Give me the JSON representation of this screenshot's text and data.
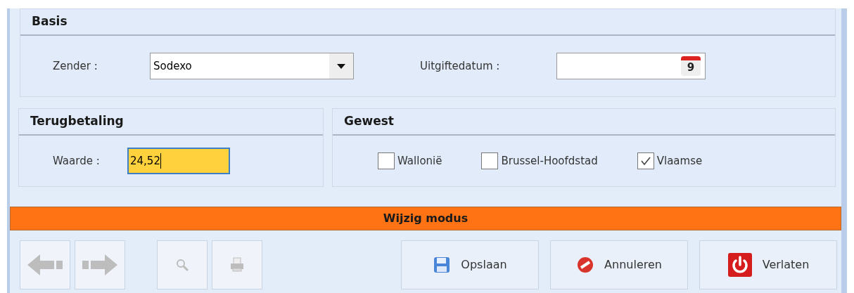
{
  "basis": {
    "title": "Basis",
    "sender": {
      "label": "Zender :",
      "value": "Sodexo"
    },
    "issue_date": {
      "label": "Uitgiftedatum :",
      "calendar_day": "9"
    }
  },
  "refund": {
    "title": "Terugbetaling",
    "amount": {
      "label": "Waarde :",
      "value": "24,52",
      "focused": true
    }
  },
  "region": {
    "title": "Gewest",
    "options": [
      {
        "label": "Wallonië",
        "checked": false
      },
      {
        "label": "Brussel-Hoofdstad",
        "checked": false
      },
      {
        "label": "Vlaamse",
        "checked": true
      }
    ]
  },
  "mode_bar": {
    "text": "Wijzig modus"
  },
  "tools": [
    {
      "kind": "previous",
      "disabled": true
    },
    {
      "kind": "next",
      "disabled": true
    },
    {
      "kind": "search",
      "disabled": true
    },
    {
      "kind": "print",
      "disabled": true
    }
  ],
  "actions": [
    {
      "kind": "save",
      "label": "Opslaan"
    },
    {
      "kind": "cancel",
      "label": "Annuleren"
    },
    {
      "kind": "exit",
      "label": "Verlaten"
    }
  ]
}
